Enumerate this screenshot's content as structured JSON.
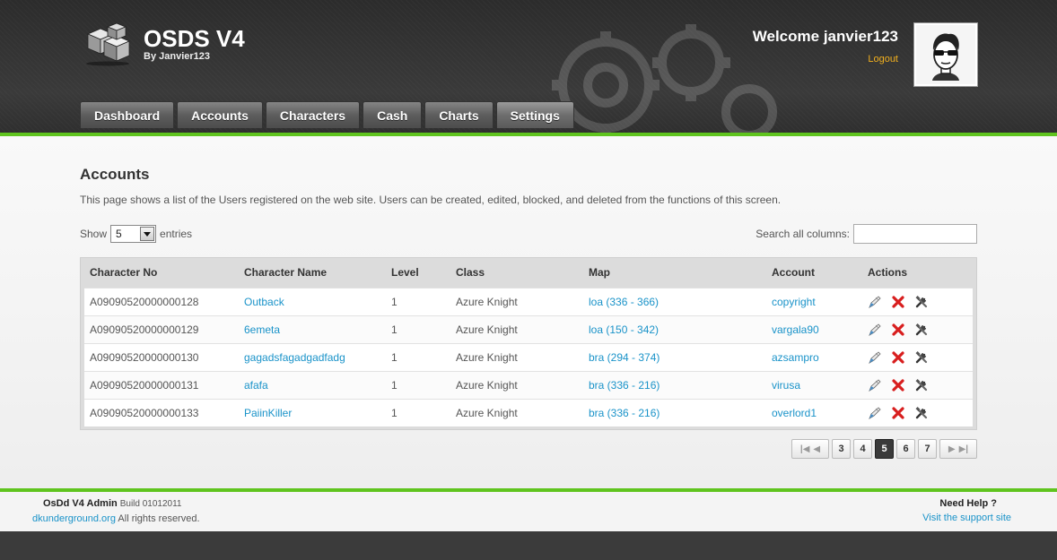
{
  "brand": {
    "title": "OSDS V4",
    "subtitle": "By Janvier123"
  },
  "user": {
    "welcome": "Welcome janvier123",
    "logout": "Logout"
  },
  "nav": {
    "items": [
      "Dashboard",
      "Accounts",
      "Characters",
      "Cash",
      "Charts",
      "Settings"
    ],
    "active": "Settings"
  },
  "page": {
    "title": "Accounts",
    "description": "This page shows a list of the Users registered on the web site. Users can be created, edited, blocked, and deleted from the functions of this screen."
  },
  "controls": {
    "show_label": "Show",
    "entries_value": "5",
    "entries_label": "entries",
    "search_label": "Search all columns:",
    "search_value": ""
  },
  "table": {
    "headers": [
      "Character No",
      "Character Name",
      "Level",
      "Class",
      "Map",
      "Account",
      "Actions"
    ],
    "rows": [
      {
        "no": "A09090520000000128",
        "name": "Outback",
        "level": "1",
        "class": "Azure Knight",
        "map": "loa (336 - 366)",
        "account": "copyright"
      },
      {
        "no": "A09090520000000129",
        "name": "6emeta",
        "level": "1",
        "class": "Azure Knight",
        "map": "loa (150 - 342)",
        "account": "vargala90"
      },
      {
        "no": "A09090520000000130",
        "name": "gagadsfagadgadfadg",
        "level": "1",
        "class": "Azure Knight",
        "map": "bra (294 - 374)",
        "account": "azsampro"
      },
      {
        "no": "A09090520000000131",
        "name": "afafa",
        "level": "1",
        "class": "Azure Knight",
        "map": "bra (336 - 216)",
        "account": "virusa"
      },
      {
        "no": "A09090520000000133",
        "name": "PaiinKiller",
        "level": "1",
        "class": "Azure Knight",
        "map": "bra (336 - 216)",
        "account": "overlord1"
      }
    ],
    "actions": [
      "edit-icon",
      "delete-icon",
      "tools-icon"
    ]
  },
  "pagination": {
    "pages": [
      "3",
      "4",
      "5",
      "6",
      "7"
    ],
    "current": "5"
  },
  "footer": {
    "title": "OsDd V4 Admin",
    "build": "Build 01012011",
    "site_link": "dkunderground.org",
    "rights": "All rights reserved.",
    "help": "Need Help ?",
    "support": "Visit the support site"
  },
  "colors": {
    "accent_green": "#5fc41e",
    "link": "#1a93c9",
    "logout": "#f2b01e",
    "delete_red": "#d81e1e"
  }
}
